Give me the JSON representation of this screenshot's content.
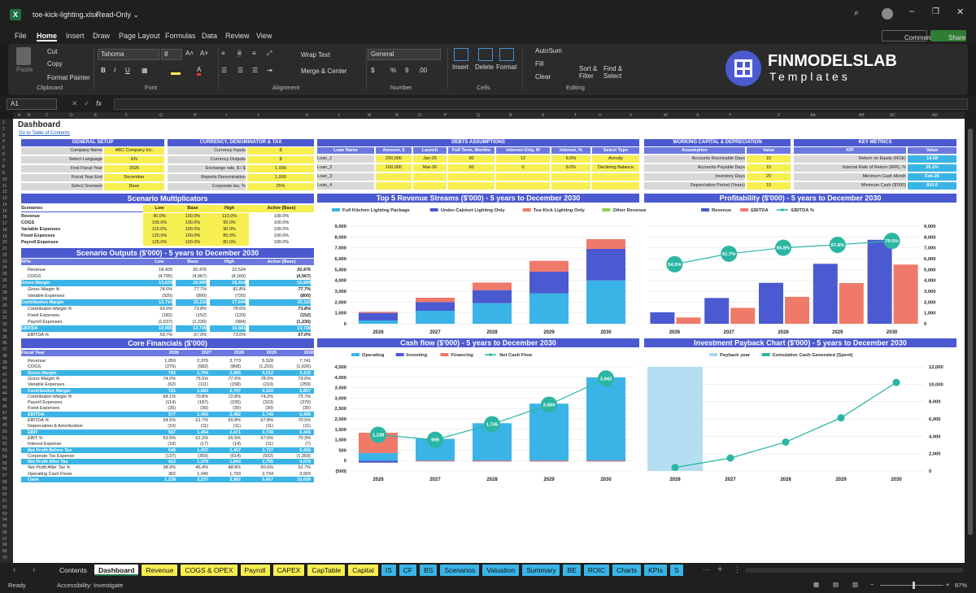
{
  "titlebar": {
    "file": "toe-kick-lighting.xlsx",
    "mode": "Read-Only ⌄"
  },
  "menu": [
    "File",
    "Home",
    "Insert",
    "Draw",
    "Page Layout",
    "Formulas",
    "Data",
    "Review",
    "View"
  ],
  "actions": {
    "comments": "Comments",
    "share": "Share"
  },
  "ribbon": {
    "clipboard": {
      "paste": "Paste",
      "cut": "Cut",
      "copy": "Copy",
      "painter": "Format Painter",
      "label": "Clipboard"
    },
    "font": {
      "name": "Tahoma",
      "size": "8",
      "label": "Font"
    },
    "alignment": {
      "wrap": "Wrap Text",
      "merge": "Merge & Center",
      "label": "Alignment"
    },
    "number": {
      "format": "General",
      "label": "Number"
    },
    "cells": {
      "insert": "Insert",
      "delete": "Delete",
      "format": "Format",
      "label": "Cells"
    },
    "editing": {
      "autosum": "AutoSum",
      "fill": "Fill",
      "clear": "Clear",
      "sort": "Sort & Filter",
      "find": "Find & Select",
      "label": "Editing"
    }
  },
  "brand": {
    "name": "FINMODELSLAB",
    "tag": "Templates"
  },
  "formula": {
    "cellref": "A1",
    "fx": "fx"
  },
  "columns": [
    "A",
    "B",
    "C",
    "D",
    "E",
    "F",
    "G",
    "H",
    "I",
    "J",
    "K",
    "L",
    "M",
    "N",
    "O",
    "P",
    "Q",
    "R",
    "S",
    "T",
    "U",
    "V",
    "W",
    "X",
    "Y",
    "Z",
    "AA",
    "AB",
    "AC",
    "AD"
  ],
  "sheet": {
    "title": "Dashboard",
    "link": "Go to Table of Contents",
    "general": {
      "head": "GENERAL SETUP",
      "rows": [
        [
          "Company Name",
          "ABC Company Inc."
        ],
        [
          "Select Language",
          "EN"
        ],
        [
          "First Fiscal Year",
          "2026"
        ],
        [
          "Fiscal Year End",
          "December"
        ],
        [
          "Select Scenario",
          "Base"
        ]
      ]
    },
    "currency": {
      "head": "CURRENCY, DENOMINATOR & TAX",
      "rows": [
        [
          "Currency Inputs",
          "$"
        ],
        [
          "Currency Outputs",
          "$"
        ],
        [
          "Exchange rate, $ / $",
          "1.000"
        ],
        [
          "Reports Denomination",
          "1,000"
        ],
        [
          "Corporate tax, %",
          "25%"
        ]
      ]
    },
    "debts": {
      "head": "DEBTS ASSUMPTIONS",
      "cols": [
        "Loan Name",
        "Amount, $",
        "Launch",
        "Full Term, Months",
        "Interest-Only, M",
        "Interest, %",
        "Select Type"
      ],
      "rows": [
        [
          "Loan_1",
          "200,000",
          "Jan-26",
          "90",
          "12",
          "6.0%",
          "Annuity"
        ],
        [
          "Loan_2",
          "100,000",
          "Mar-26",
          "60",
          "0",
          "8.0%",
          "Declining Balance"
        ],
        [
          "Loan_3",
          "",
          "",
          "",
          "",
          "",
          ""
        ],
        [
          "Loan_4",
          "",
          "",
          "",
          "",
          "",
          ""
        ]
      ]
    },
    "wc": {
      "head": "WORKING CAPITAL & DEPRECIATION",
      "cols": [
        "Assumption",
        "Value"
      ],
      "rows": [
        [
          "Accounts Receivable Days",
          "15"
        ],
        [
          "Accounts Payable Days",
          "15"
        ],
        [
          "Inventory Days",
          "20"
        ],
        [
          "Depreciation Period (Years)",
          "10"
        ]
      ]
    },
    "kpi": {
      "head": "KEY METRICS",
      "cols": [
        "KPI",
        "Value"
      ],
      "rows": [
        [
          "Return on Equity (ROE)",
          "14.58"
        ],
        [
          "Internal Rate of Return (IRR), %",
          "25.1%"
        ],
        [
          "Minimum Cash Month",
          "Feb-26"
        ],
        [
          "Minimum Cash ($'000)",
          "810.0"
        ]
      ]
    },
    "multipliers": {
      "head": "Scenario Multiplicators",
      "cols": [
        "Scenarios",
        "Low",
        "Base",
        "High",
        "Active (Base)"
      ],
      "rows": [
        [
          "Revenue",
          "90.0%",
          "100.0%",
          "110.0%",
          "100.0%"
        ],
        [
          "COGS",
          "105.0%",
          "100.0%",
          "95.0%",
          "100.0%"
        ],
        [
          "Variable Expenses",
          "115.0%",
          "100.0%",
          "90.0%",
          "100.0%"
        ],
        [
          "Fixed Expenses",
          "120.0%",
          "100.0%",
          "85.0%",
          "100.0%"
        ],
        [
          "Payroll Expenses",
          "125.0%",
          "100.0%",
          "80.0%",
          "100.0%"
        ]
      ]
    },
    "outputs": {
      "head": "Scenario Outputs ($'000) - 5 years to December 2030",
      "cols": [
        "KPIs",
        "Low",
        "Base",
        "High",
        "Active (Base)"
      ],
      "rows": [
        [
          "Revenue",
          "18,429",
          "20,476",
          "22,524",
          "20,476",
          "n"
        ],
        [
          "COGS",
          "(4,795)",
          "(4,567)",
          "(4,160)",
          "(4,567)",
          "n"
        ],
        [
          "Gross Margin",
          "13,633",
          "15,909",
          "18,414",
          "15,909",
          "h"
        ],
        [
          "Gross Margin %",
          "74.0%",
          "77.7%",
          "81.8%",
          "77.7%",
          "i"
        ],
        [
          "Variable Expenses",
          "(920)",
          "(800)",
          "(720)",
          "(800)",
          "n"
        ],
        [
          "Contribution Margin",
          "12,714",
          "15,110",
          "17,644",
          "15,110",
          "h"
        ],
        [
          "Contribution Margin %",
          "69.0%",
          "73.8%",
          "78.6%",
          "73.8%",
          "i"
        ],
        [
          "Fixed Expenses",
          "(182)",
          "(152)",
          "(129)",
          "(152)",
          "n"
        ],
        [
          "Payroll Expenses",
          "(1,537)",
          "(1,230)",
          "(984)",
          "(1,230)",
          "n"
        ],
        [
          "EBITDA",
          "10,995",
          "13,728",
          "16,581",
          "13,728",
          "h"
        ],
        [
          "EBITDA %",
          "59.7%",
          "67.0%",
          "73.6%",
          "67.0%",
          "i"
        ]
      ]
    },
    "core": {
      "head": "Core Financials ($'000)",
      "cols": [
        "Fiscal Year",
        "2026",
        "2027",
        "2028",
        "2029",
        "2030"
      ],
      "rows": [
        [
          "Revenue",
          "1,059",
          "2,376",
          "3,773",
          "5,528",
          "7,741",
          "n"
        ],
        [
          "COGS",
          "(275)",
          "(582)",
          "(868)",
          "(1,216)",
          "(1,626)",
          "n"
        ],
        [
          "Gross Margin",
          "783",
          "1,794",
          "2,905",
          "4,312",
          "6,115",
          "h"
        ],
        [
          "Gross Margin %",
          "74.0%",
          "75.5%",
          "77.0%",
          "78.0%",
          "79.0%",
          "i"
        ],
        [
          "Variable Expenses",
          "(62)",
          "(111)",
          "(158)",
          "(210)",
          "(259)",
          "n"
        ],
        [
          "Contribution Margin",
          "721",
          "1,683",
          "2,747",
          "4,102",
          "5,857",
          "h"
        ],
        [
          "Contribution Margin %",
          "68.1%",
          "70.8%",
          "72.8%",
          "74.2%",
          "75.7%",
          "i"
        ],
        [
          "Payroll Expenses",
          "(114)",
          "(187)",
          "(235)",
          "(323)",
          "(370)",
          "n"
        ],
        [
          "Fixed Expenses",
          "(30)",
          "(30)",
          "(30)",
          "(30)",
          "(30)",
          "n"
        ],
        [
          "EBITDA",
          "577",
          "1,465",
          "2,482",
          "3,749",
          "5,456",
          "h"
        ],
        [
          "EBITDA %",
          "54.5%",
          "61.7%",
          "65.8%",
          "67.8%",
          "70.5%",
          "i"
        ],
        [
          "Depreciation & Amortization",
          "(10)",
          "(11)",
          "(11)",
          "(11)",
          "(11)",
          "n"
        ],
        [
          "EBIT",
          "567",
          "1,454",
          "2,471",
          "3,738",
          "5,445",
          "h"
        ],
        [
          "EBIT %",
          "53.5%",
          "61.2%",
          "65.5%",
          "67.6%",
          "70.3%",
          "i"
        ],
        [
          "Interest Expense",
          "(18)",
          "(17)",
          "(14)",
          "(11)",
          "(7)",
          "n"
        ],
        [
          "Net Profit Before Tax",
          "549",
          "1,437",
          "2,457",
          "3,727",
          "5,438",
          "h"
        ],
        [
          "Corporate Tax Expense",
          "(137)",
          "(359)",
          "(614)",
          "(932)",
          "(1,359)",
          "n"
        ],
        [
          "Net Profit After Tax",
          "412",
          "1,078",
          "1,843",
          "2,795",
          "4,078",
          "h"
        ],
        [
          "Net Profit After Tax %",
          "38.9%",
          "45.4%",
          "48.8%",
          "50.6%",
          "52.7%",
          "i"
        ],
        [
          "Operating Cash Flows",
          "362",
          "1,045",
          "1,793",
          "2,734",
          "3,993",
          "n"
        ],
        [
          "Cash",
          "1,238",
          "2,237",
          "3,982",
          "6,667",
          "10,609",
          "h"
        ]
      ]
    }
  },
  "chart_data": [
    {
      "type": "bar",
      "title": "Top 5 Revenue Streams ($'000) - 5 years to December 2030",
      "categories": [
        "2026",
        "2027",
        "2028",
        "2029",
        "2030"
      ],
      "ylim": [
        0,
        9000
      ],
      "stacked": true,
      "series": [
        {
          "name": "Full Kitchen Lighting Package",
          "color": "#3ab4e6",
          "values": [
            300,
            1200,
            1900,
            2800,
            4000
          ]
        },
        {
          "name": "Under-Cabinet Lighting Only",
          "color": "#4b5ad0",
          "values": [
            700,
            800,
            1200,
            2000,
            2900
          ]
        },
        {
          "name": "Toe-Kick Lighting Only",
          "color": "#f07a6a",
          "values": [
            100,
            400,
            700,
            1000,
            900
          ]
        },
        {
          "name": "",
          "color": "#999999",
          "values": [
            0,
            0,
            0,
            0,
            0
          ]
        },
        {
          "name": "Other Revenue",
          "color": "#8cd24a",
          "values": [
            0,
            0,
            0,
            0,
            0
          ]
        }
      ]
    },
    {
      "type": "bar",
      "title": "Profitability ($'000) - 5 years to December 2030",
      "categories": [
        "2026",
        "2027",
        "2028",
        "2029",
        "2030"
      ],
      "ylim": [
        0,
        9000
      ],
      "series": [
        {
          "name": "Revenue",
          "color": "#4b5ad0",
          "values": [
            1059,
            2376,
            3773,
            5528,
            7741
          ]
        },
        {
          "name": "EBITDA",
          "color": "#f07a6a",
          "values": [
            577,
            1465,
            2482,
            3749,
            5456
          ]
        },
        {
          "name": "EBITDA %",
          "color": "#2bb6a3",
          "line": true,
          "values": [
            54.5,
            61.7,
            65.8,
            67.8,
            70.5
          ],
          "labels": [
            "54.5%",
            "61.7%",
            "65.8%",
            "67.8%",
            "70.5%"
          ]
        }
      ]
    },
    {
      "type": "bar",
      "title": "Cash flow ($'000) - 5 years to December 2030",
      "categories": [
        "2026",
        "2027",
        "2028",
        "2029",
        "2030"
      ],
      "ylim": [
        -500,
        4500
      ],
      "series": [
        {
          "name": "Operating",
          "color": "#3ab4e6",
          "values": [
            362,
            1045,
            1793,
            2734,
            3993
          ]
        },
        {
          "name": "Investing",
          "color": "#4b5ad0",
          "values": [
            -100,
            -11,
            -11,
            -11,
            -11
          ]
        },
        {
          "name": "Financing",
          "color": "#f07a6a",
          "values": [
            976,
            -35,
            -37,
            -38,
            -40
          ]
        },
        {
          "name": "Net Cash Flow",
          "color": "#2bb6a3",
          "line": true,
          "values": [
            1238,
            999,
            1745,
            2684,
            3942
          ],
          "labels": [
            "1,238",
            "999",
            "1,745",
            "2,684",
            "3,942"
          ]
        }
      ]
    },
    {
      "type": "line",
      "title": "Investment Payback Chart ($'000) - 5 years to December 2030",
      "categories": [
        "2026",
        "2027",
        "2028",
        "2029",
        "2030"
      ],
      "ylim": [
        0,
        12000
      ],
      "series": [
        {
          "name": "Payback year",
          "color": "#a8d8f0",
          "values": [
            1,
            0,
            0,
            0,
            0
          ]
        },
        {
          "name": "Cumulative Cash Generated (Spent)",
          "color": "#2bb6a3",
          "values": [
            412,
            1490,
            3333,
            6128,
            10206
          ]
        }
      ]
    }
  ],
  "tabs": [
    [
      "Contents",
      "#1f1f1f",
      "#ddd"
    ],
    [
      "Dashboard",
      "#ffffff",
      "#111"
    ],
    [
      "Revenue",
      "#f7ee52",
      "#111"
    ],
    [
      "COGS & OPEX",
      "#f7ee52",
      "#111"
    ],
    [
      "Payroll",
      "#f7ee52",
      "#111"
    ],
    [
      "CAPEX",
      "#f7ee52",
      "#111"
    ],
    [
      "CapTable",
      "#f7ee52",
      "#111"
    ],
    [
      "Capital",
      "#f7ee52",
      "#111"
    ],
    [
      "IS",
      "#3ab4e6",
      "#111"
    ],
    [
      "CF",
      "#3ab4e6",
      "#111"
    ],
    [
      "BS",
      "#3ab4e6",
      "#111"
    ],
    [
      "Scenarios",
      "#3ab4e6",
      "#111"
    ],
    [
      "Valuation",
      "#3ab4e6",
      "#111"
    ],
    [
      "Summary",
      "#3ab4e6",
      "#111"
    ],
    [
      "BE",
      "#3ab4e6",
      "#111"
    ],
    [
      "ROIC",
      "#3ab4e6",
      "#111"
    ],
    [
      "Charts",
      "#3ab4e6",
      "#111"
    ],
    [
      "KPIs",
      "#3ab4e6",
      "#111"
    ],
    [
      "S",
      "#3ab4e6",
      "#111"
    ]
  ],
  "status": {
    "ready": "Ready",
    "access": "Accessibility: Investigate",
    "zoom": "87%"
  }
}
